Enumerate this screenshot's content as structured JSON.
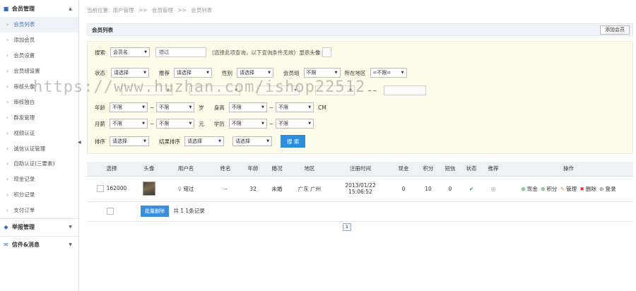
{
  "sidebar": {
    "group1": {
      "label": "会员管理"
    },
    "items": [
      {
        "label": "会员列表"
      },
      {
        "label": "添加会员"
      },
      {
        "label": "会员设置"
      },
      {
        "label": "会员组设置"
      },
      {
        "label": "审核头像"
      },
      {
        "label": "审核独白"
      },
      {
        "label": "群发管理"
      },
      {
        "label": "视频认证"
      },
      {
        "label": "诚信认证管理"
      },
      {
        "label": "自助认证(三要素)"
      },
      {
        "label": "现金记录"
      },
      {
        "label": "积分记录"
      },
      {
        "label": "支付订单"
      }
    ],
    "group2": {
      "label": "举报管理"
    },
    "group3": {
      "label": "信件&消息"
    }
  },
  "breadcrumb": {
    "prefix": "当前位置:",
    "l1": "用户管理",
    "sep": ">>",
    "l2": "会员管理",
    "l3": "会员列表"
  },
  "panel": {
    "title": "会员列表",
    "add_button": "添加会员"
  },
  "filters": {
    "search_label": "搜索",
    "search_field": "会员名",
    "search_value": "错过",
    "search_note": "(选择此项查询，以下查询条件无效)",
    "show_avatar": "显示头像",
    "status_label": "状态",
    "status_value": "请选择",
    "recommend_label": "推荐",
    "recommend_value": "请选择",
    "gender_label": "性别",
    "gender_value": "请选择",
    "group_label": "会员组",
    "group_value": "不限",
    "region_label": "所在地区",
    "region_value": "=不限=",
    "age_label": "年龄",
    "age_from": "不限",
    "age_to": "不限",
    "age_unit": "岁",
    "height_label": "身高",
    "height_from": "不限",
    "height_to": "不限",
    "height_unit": "CM",
    "salary_label": "月薪",
    "salary_from": "不限",
    "salary_to": "不限",
    "salary_unit": "元",
    "edu_label": "学历",
    "edu_from": "不限",
    "edu_to": "不限",
    "sort_label": "排序",
    "sort_value": "请选择",
    "result_sort_label": "结果排序",
    "result_sort_value": "请选择",
    "sort3_value": "请选择",
    "dash": "~",
    "search_button": "搜 索"
  },
  "table": {
    "headers": [
      "选择",
      "头像",
      "用户名",
      "姓名",
      "年龄",
      "婚况",
      "地区",
      "注册时间",
      "现金",
      "积分",
      "短信",
      "状态",
      "推荐",
      "操作"
    ],
    "rows": [
      {
        "id": "162000",
        "username": "错过",
        "name": "--",
        "age": "32",
        "marital": "未婚",
        "region": "广东 广州",
        "reg_date": "2013/01/22",
        "reg_time": "15:06:52",
        "cash": "0",
        "points": "10",
        "sms": "0"
      }
    ],
    "actions": {
      "cash": "现金",
      "points": "积分",
      "manage": "管理",
      "delete": "删除",
      "login": "登录"
    },
    "bulk_delete": "批量删除",
    "total": "共 1 1条记录"
  },
  "pager": {
    "page": "1"
  },
  "watermark": "https://www.huzhan.com/ishop22512",
  "colors": {
    "accent": "#2d8ee0",
    "filter_bg": "#fdfbe9"
  }
}
